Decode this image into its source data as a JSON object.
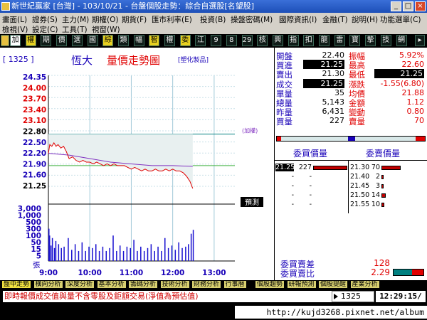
{
  "window": {
    "title": "新世紀贏家 [台灣] - 103/10/21 - 台盤個股走勢：綜合自選股[名望股]",
    "min": "_",
    "max": "□",
    "close": "×"
  },
  "menu": {
    "row1": [
      "畫面(L)",
      "證券(S)",
      "主力(M)",
      "期權(O)",
      "期貨(F)",
      "匯市利率(E)",
      "投資(B)",
      "操盤密碼(M)",
      "國際資訊(I)",
      "金融(T)",
      "說明(H)",
      "功能選單(C)"
    ],
    "row2": [
      "檢視(V)",
      "設定(C)",
      "工具(T)",
      "視窗(W)"
    ]
  },
  "toolbar": [
    "加",
    "權",
    "期",
    "價",
    "選",
    "國",
    "綜",
    "類",
    "幅",
    "智",
    "權",
    "委",
    "江",
    "9",
    "8",
    "29",
    "核",
    "興",
    "指",
    "扣",
    "龍",
    "雷",
    "寶",
    "摯",
    "技",
    "網"
  ],
  "chart": {
    "stock_code": "[ 1325 ]",
    "stock_name": "恆大",
    "chart_title": "量價走勢圖",
    "category": "[塑化製品]",
    "ref_label": "(加權)",
    "latest_box": "預測",
    "vol_unit": "張"
  },
  "chart_data": {
    "type": "line",
    "price_ticks": [
      "24.35",
      "24.00",
      "23.70",
      "23.40",
      "23.10",
      "22.80",
      "22.50",
      "22.20",
      "21.90",
      "21.60",
      "21.25"
    ],
    "volume_ticks": [
      "3,000",
      "1,000",
      "500",
      "300",
      "100",
      "50",
      "15",
      "5"
    ],
    "x_ticks": [
      "9:00",
      "10:00",
      "11:00",
      "12:00",
      "13:00"
    ],
    "prev_close": 22.8,
    "price_series": [
      [
        "9:00",
        22.25
      ],
      [
        "9:02",
        22.5
      ],
      [
        "9:05",
        22.45
      ],
      [
        "9:08",
        22.55
      ],
      [
        "9:11",
        22.45
      ],
      [
        "9:14",
        22.5
      ],
      [
        "9:18",
        22.4
      ],
      [
        "9:22",
        22.45
      ],
      [
        "9:26",
        22.3
      ],
      [
        "9:30",
        22.1
      ],
      [
        "9:35",
        22.15
      ],
      [
        "9:40",
        22.05
      ],
      [
        "9:45",
        22.0
      ],
      [
        "9:50",
        22.05
      ],
      [
        "9:55",
        22.0
      ],
      [
        "10:00",
        22.0
      ],
      [
        "10:05",
        21.95
      ],
      [
        "10:10",
        22.0
      ],
      [
        "10:15",
        21.95
      ],
      [
        "10:20",
        21.9
      ],
      [
        "10:25",
        21.95
      ],
      [
        "10:30",
        21.9
      ],
      [
        "10:35",
        21.95
      ],
      [
        "10:40",
        21.9
      ],
      [
        "10:45",
        21.9
      ],
      [
        "10:50",
        21.9
      ],
      [
        "10:55",
        21.85
      ],
      [
        "11:00",
        21.8
      ],
      [
        "11:05",
        21.85
      ],
      [
        "11:10",
        21.8
      ],
      [
        "11:15",
        21.75
      ],
      [
        "11:20",
        21.8
      ],
      [
        "11:25",
        21.75
      ],
      [
        "11:30",
        21.75
      ],
      [
        "11:35",
        21.8
      ],
      [
        "11:40",
        21.75
      ],
      [
        "11:45",
        21.75
      ],
      [
        "11:50",
        21.8
      ],
      [
        "11:55",
        21.75
      ],
      [
        "12:00",
        21.8
      ],
      [
        "12:05",
        21.75
      ],
      [
        "12:10",
        21.75
      ],
      [
        "12:15",
        21.7
      ],
      [
        "12:20",
        21.6
      ],
      [
        "12:25",
        21.45
      ],
      [
        "12:28",
        21.3
      ],
      [
        "12:29",
        21.25
      ]
    ],
    "avg_series": [
      [
        "9:00",
        22.25
      ],
      [
        "9:30",
        22.2
      ],
      [
        "10:00",
        22.1
      ],
      [
        "10:30",
        22.0
      ],
      [
        "11:00",
        21.95
      ],
      [
        "11:30",
        21.9
      ],
      [
        "12:00",
        21.9
      ],
      [
        "12:29",
        21.88
      ]
    ],
    "volume_series": [
      [
        "9:00",
        180
      ],
      [
        "9:01",
        60
      ],
      [
        "9:03",
        12
      ],
      [
        "9:05",
        40
      ],
      [
        "9:08",
        8
      ],
      [
        "9:10",
        25
      ],
      [
        "9:14",
        15
      ],
      [
        "9:18",
        8
      ],
      [
        "9:22",
        10
      ],
      [
        "9:28",
        40
      ],
      [
        "9:33",
        6
      ],
      [
        "9:38",
        15
      ],
      [
        "9:43",
        5
      ],
      [
        "9:48",
        20
      ],
      [
        "9:53",
        5
      ],
      [
        "9:58",
        10
      ],
      [
        "10:03",
        8
      ],
      [
        "10:08",
        15
      ],
      [
        "10:13",
        5
      ],
      [
        "10:18",
        10
      ],
      [
        "10:23",
        5
      ],
      [
        "10:28",
        8
      ],
      [
        "10:33",
        60
      ],
      [
        "10:38",
        5
      ],
      [
        "10:43",
        12
      ],
      [
        "10:48",
        5
      ],
      [
        "10:53",
        10
      ],
      [
        "10:58",
        8
      ],
      [
        "11:03",
        30
      ],
      [
        "11:08",
        5
      ],
      [
        "11:13",
        10
      ],
      [
        "11:18",
        5
      ],
      [
        "11:23",
        8
      ],
      [
        "11:28",
        15
      ],
      [
        "11:33",
        5
      ],
      [
        "11:38",
        10
      ],
      [
        "11:43",
        5
      ],
      [
        "11:48",
        40
      ],
      [
        "11:53",
        8
      ],
      [
        "11:58",
        12
      ],
      [
        "12:03",
        6
      ],
      [
        "12:08",
        20
      ],
      [
        "12:13",
        8
      ],
      [
        "12:18",
        10
      ],
      [
        "12:22",
        15
      ],
      [
        "12:26",
        80
      ],
      [
        "12:29",
        150
      ]
    ]
  },
  "quote": {
    "left": [
      {
        "label": "開盤",
        "value": "22.40",
        "inv": false
      },
      {
        "label": "買進",
        "value": "21.25",
        "inv": true
      },
      {
        "label": "賣出",
        "value": "21.30",
        "inv": false
      },
      {
        "label": "成交",
        "value": "21.25",
        "inv": true
      },
      {
        "label": "單量",
        "value": "35",
        "inv": false
      },
      {
        "label": "總量",
        "value": "5,143",
        "inv": false
      },
      {
        "label": "昨量",
        "value": "6,431",
        "inv": false
      },
      {
        "label": "買量",
        "value": "227",
        "inv": false
      }
    ],
    "right": [
      {
        "label": "振幅",
        "value": "5.92%",
        "inv": false
      },
      {
        "label": "最高",
        "value": "22.60",
        "inv": false
      },
      {
        "label": "最低",
        "value": "21.25",
        "inv": true
      },
      {
        "label": "漲跌",
        "value": "-1.55(6.80)",
        "inv": false
      },
      {
        "label": "均價",
        "value": "21.88",
        "inv": false
      },
      {
        "label": "金額",
        "value": "1.12",
        "inv": false
      },
      {
        "label": "變動",
        "value": "0.80",
        "inv": false
      },
      {
        "label": "賣量",
        "value": "70",
        "inv": false
      }
    ]
  },
  "orderbook": {
    "bid_header": "委買價量",
    "ask_header": "委賣價量",
    "bids": [
      {
        "price": "21.25",
        "qty": "227",
        "bar": 1.0
      },
      {
        "price": "-",
        "qty": "-",
        "bar": 0
      },
      {
        "price": "-",
        "qty": "-",
        "bar": 0
      },
      {
        "price": "-",
        "qty": "-",
        "bar": 0
      },
      {
        "price": "-",
        "qty": "-",
        "bar": 0
      }
    ],
    "asks": [
      {
        "price": "21.30",
        "qty": "70",
        "bar": 0.45
      },
      {
        "price": "21.40",
        "qty": "2",
        "bar": 0.02
      },
      {
        "price": "21.45",
        "qty": "3",
        "bar": 0.03
      },
      {
        "price": "21.50",
        "qty": "14",
        "bar": 0.1
      },
      {
        "price": "21.55",
        "qty": "10",
        "bar": 0.07
      }
    ],
    "diff_label": "委買賣差",
    "diff_value": "128",
    "ratio_label": "委買賣比",
    "ratio_value": "2.29"
  },
  "tabs": [
    "盤中走勢",
    "橫向分析",
    "深度分析",
    "基本分析",
    "籌碼分析",
    "技術分析",
    "財務分析",
    "行事曆",
    "個股趨勢",
    "研報預測",
    "個股提醒",
    "產業分析"
  ],
  "status": {
    "marquee": "即時報價成交值與量不含零股及鉅額交易(淨值為預估值)",
    "code": "1325",
    "clock": "12:29:15/",
    "url": "http://kujd3268.pixnet.net/album"
  },
  "colors": {
    "price_line": "#e00000",
    "avg_line": "#8030c0",
    "volume": "#1810d0",
    "label_blue": "#1800b8",
    "label_red": "#e00000"
  }
}
